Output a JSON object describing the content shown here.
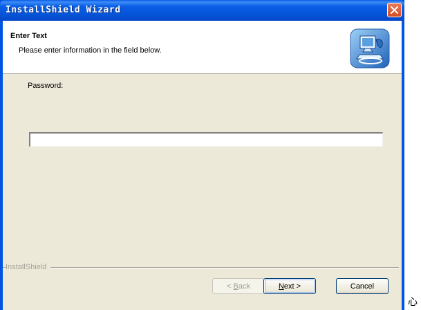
{
  "window": {
    "title": "InstallShield Wizard",
    "colors": {
      "titlebar": "#0054e3",
      "client": "#ece9d8",
      "close": "#d44d20"
    }
  },
  "header": {
    "title": "Enter Text",
    "subtitle": "Please enter information in the field below.",
    "icon": "computer-setup-icon"
  },
  "form": {
    "label": "Password:",
    "value": ""
  },
  "brand": {
    "text": "InstallShield"
  },
  "buttons": {
    "back": {
      "prefix": "< ",
      "mnemonic": "B",
      "rest": "ack"
    },
    "next": {
      "mnemonic": "N",
      "rest": "ext >"
    },
    "cancel": "Cancel"
  },
  "stray_text": "心"
}
